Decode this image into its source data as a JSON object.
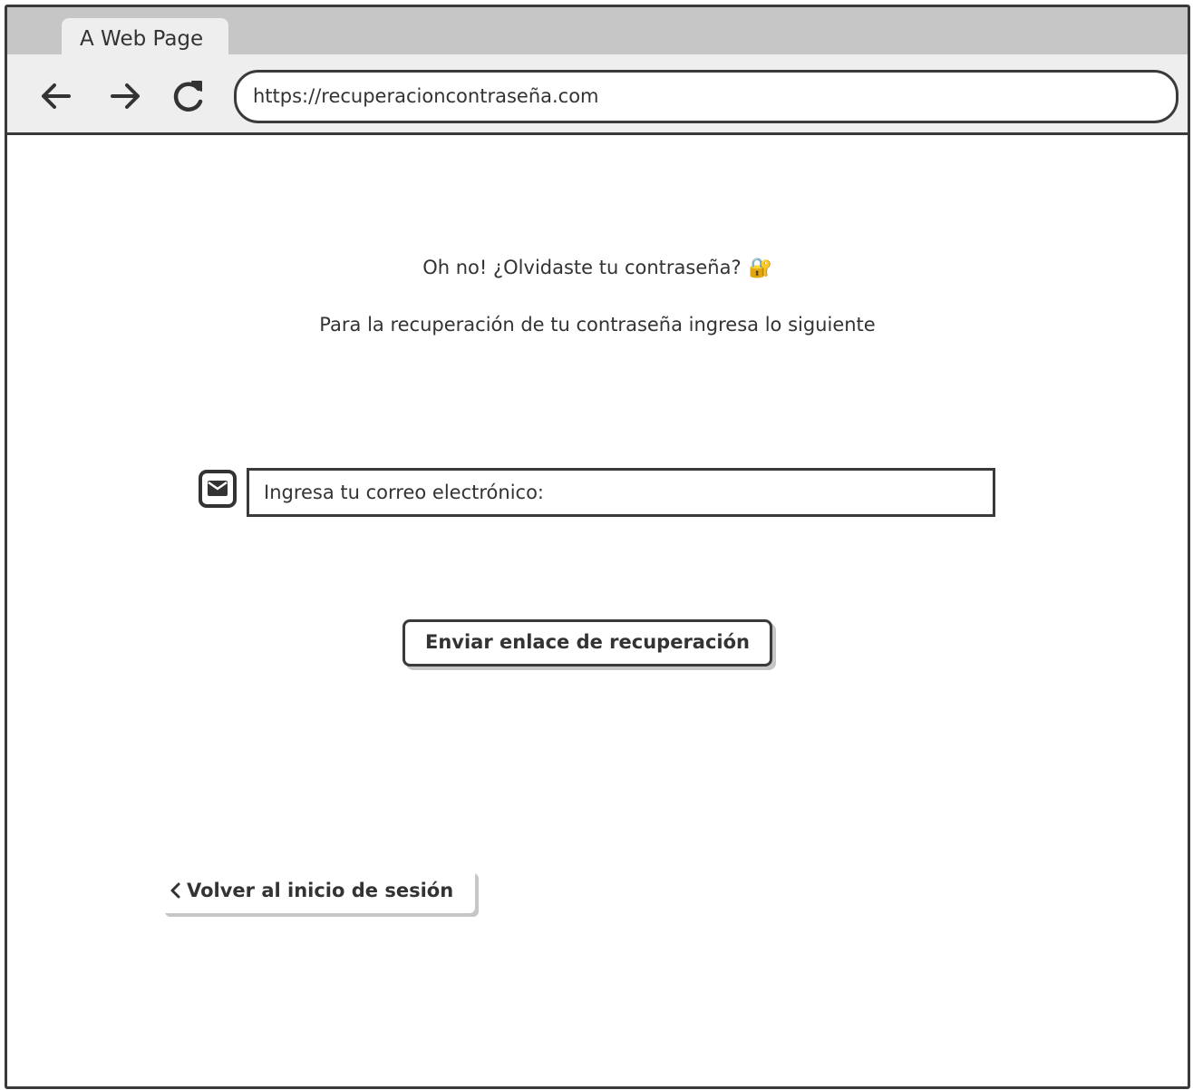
{
  "browser": {
    "tab_title": "A Web Page",
    "url": "https://recuperacioncontraseña.com",
    "icons": {
      "back": "arrow-left-icon",
      "forward": "arrow-right-icon",
      "reload": "reload-icon"
    }
  },
  "page": {
    "heading": "Oh no! ¿Olvidaste tu contraseña?",
    "heading_emoji": "🔐",
    "subheading": "Para la recuperación de tu contraseña ingresa lo siguiente",
    "email_field_label": "Ingresa tu correo electrónico:",
    "email_icon": "envelope-icon",
    "send_button_label": "Enviar enlace de recuperación",
    "back_link_label": "Volver al inicio de sesión",
    "back_link_icon": "chevron-left-icon"
  }
}
